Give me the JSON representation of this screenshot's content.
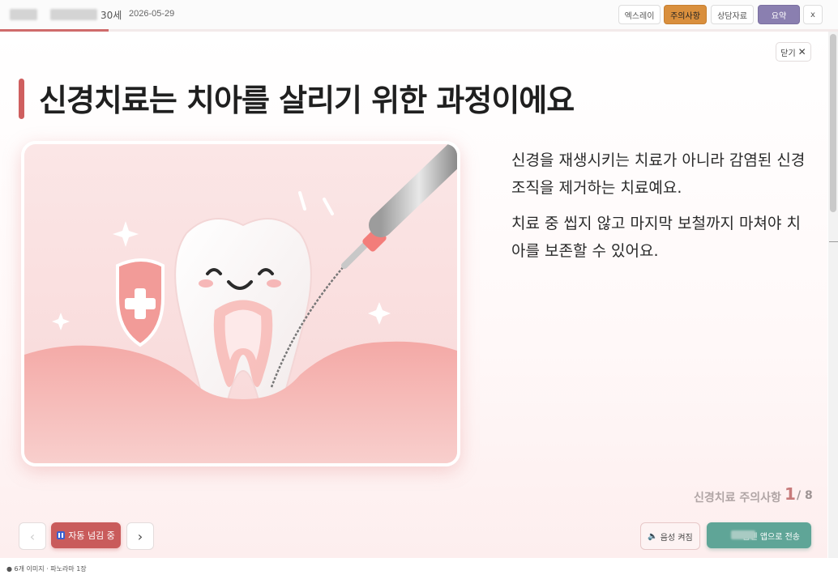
{
  "header": {
    "age": "30세",
    "date": "2026-05-29",
    "buttons": [
      {
        "label": "엑스레이"
      },
      {
        "label": "주의사항"
      },
      {
        "label": "상담자료"
      },
      {
        "label": "요약"
      },
      {
        "label": "x"
      }
    ],
    "progress": 0.13
  },
  "slide": {
    "close_label": "닫기",
    "title": "신경치료는 치아를 살리기 위한 과정이에요",
    "paragraphs": [
      "신경을 재생시키는 치료가 아니라 감염된 신경 조직을 제거하는 치료예요.",
      "치료 중 씹지 않고 마지막 보철까지 마쳐야 치아를 보존할 수 있어요."
    ],
    "illustration": "tooth-root-canal-illustration"
  },
  "counter": {
    "label": "신경치료 주의사항",
    "current": "1",
    "total": "/ 8"
  },
  "controls": {
    "prev_icon": "‹",
    "next_icon": "›",
    "auto_label": "자동 넘김 중",
    "voice_label": "음성 켜짐",
    "voice_icon": "🔈",
    "send_label": "홈덴 앱으로 전송"
  },
  "footer": {
    "text": "● 6개 이미지 · 파노라마 1장"
  },
  "colors": {
    "accent": "#cf5f5f",
    "send": "#5fa597",
    "summary": "#8a7fb0",
    "caution": "#d98f3d"
  }
}
